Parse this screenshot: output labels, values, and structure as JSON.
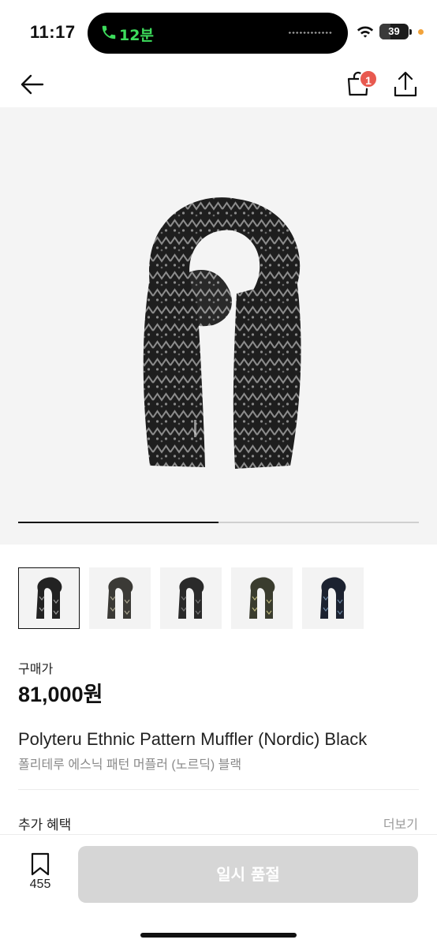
{
  "status_bar": {
    "time": "11:17",
    "call_timer": "12분",
    "battery_level": "39",
    "battery_fraction": 0.39
  },
  "nav": {
    "cart_badge_count": "1"
  },
  "gallery": {
    "progress_fraction": 0.5,
    "thumbnail_count": 5
  },
  "product": {
    "price_label": "구매가",
    "price": "81,000원",
    "title_en": "Polyteru Ethnic Pattern Muffler (Nordic) Black",
    "title_ko": "폴리테루 에스닉 패턴 머플러 (노르딕) 블랙"
  },
  "benefits": {
    "label": "추가 혜택",
    "more_link": "더보기"
  },
  "bottom_bar": {
    "bookmark_count": "455",
    "action_label": "일시 품절"
  },
  "colors": {
    "call_green": "#3ddc5c",
    "badge_red": "#e8594f",
    "disabled_button": "#d6d6d6",
    "image_background": "#f4f4f4"
  },
  "icons": [
    "phone-icon",
    "wifi-icon",
    "battery-icon",
    "back-arrow-icon",
    "shopping-bag-icon",
    "share-icon",
    "bookmark-icon"
  ]
}
